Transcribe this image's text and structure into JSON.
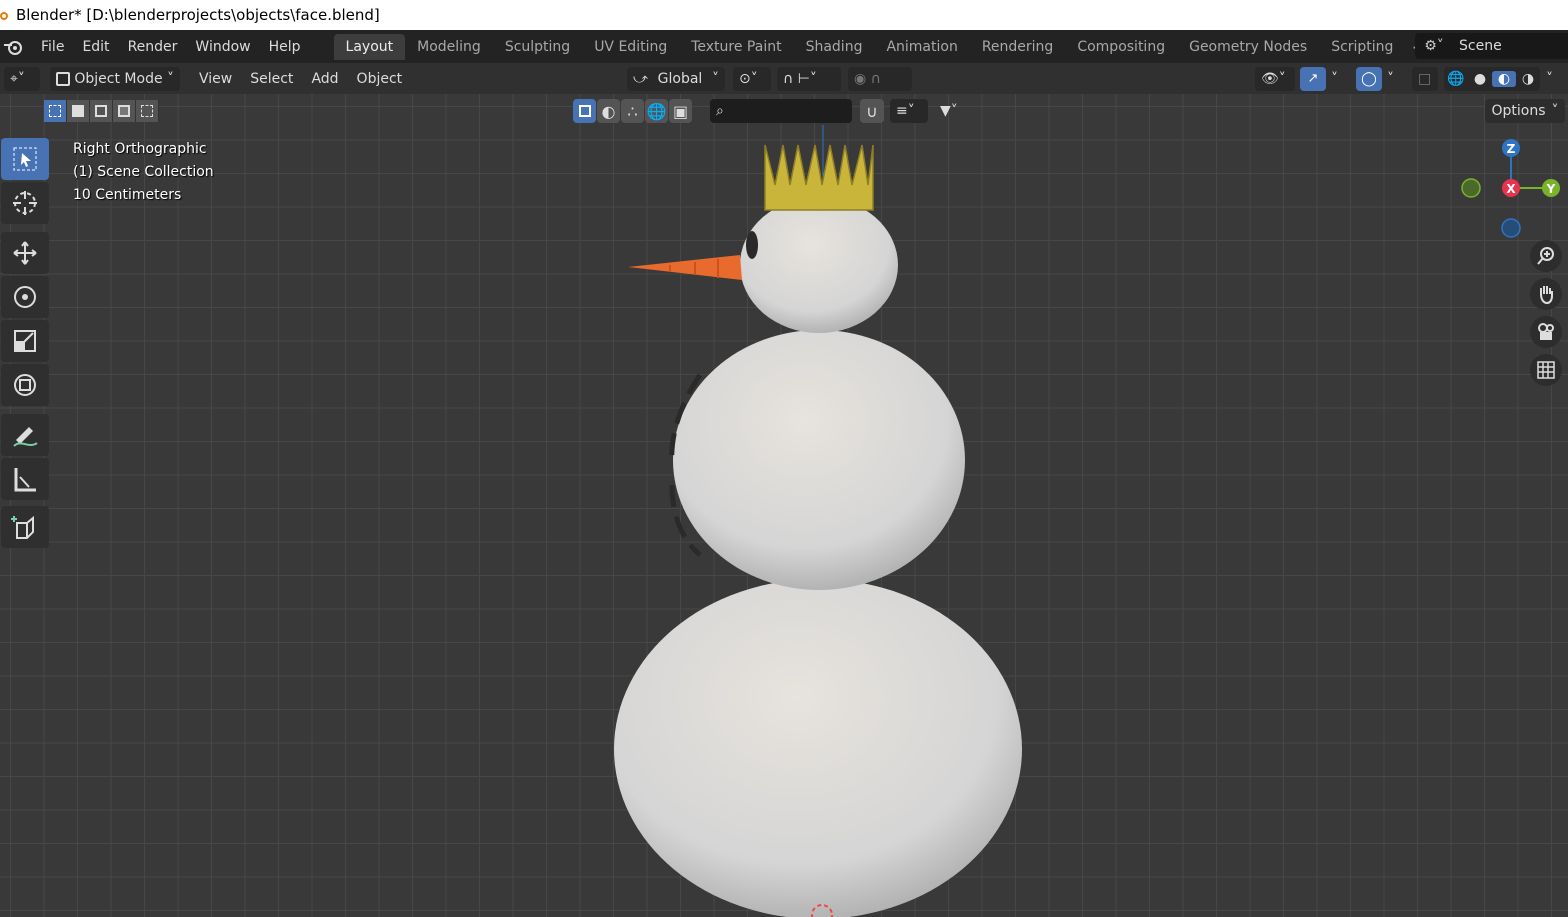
{
  "window": {
    "title": "Blender* [D:\\blenderprojects\\objects\\face.blend]"
  },
  "menu": [
    "File",
    "Edit",
    "Render",
    "Window",
    "Help"
  ],
  "workspaces": [
    "Layout",
    "Modeling",
    "Sculpting",
    "UV Editing",
    "Texture Paint",
    "Shading",
    "Animation",
    "Rendering",
    "Compositing",
    "Geometry Nodes",
    "Scripting"
  ],
  "active_workspace": "Layout",
  "scene": {
    "name": "Scene"
  },
  "header": {
    "mode": "Object Mode",
    "view": "View",
    "select": "Select",
    "add": "Add",
    "object": "Object",
    "orientation": "Global",
    "options": "Options"
  },
  "viewport": {
    "view_name": "Right Orthographic",
    "collection": "(1) Scene Collection",
    "scale": "10 Centimeters"
  },
  "gizmo": {
    "z": "Z",
    "x": "X",
    "y": "Y"
  },
  "colors": {
    "accent": "#4772b3",
    "axis_x": "#e8324e",
    "axis_y": "#79b32a",
    "axis_z": "#2f74c4",
    "crown": "#c9b53a",
    "carrot": "#e86a2c",
    "snow": "#e6e6e4"
  },
  "icons": {
    "tools": [
      "select-box-icon",
      "cursor-icon",
      "move-icon",
      "rotate-icon",
      "scale-icon",
      "transform-icon",
      "annotate-icon",
      "measure-icon",
      "add-cube-icon"
    ],
    "nav": [
      "zoom-icon",
      "hand-icon",
      "camera-icon",
      "grid-icon"
    ]
  }
}
